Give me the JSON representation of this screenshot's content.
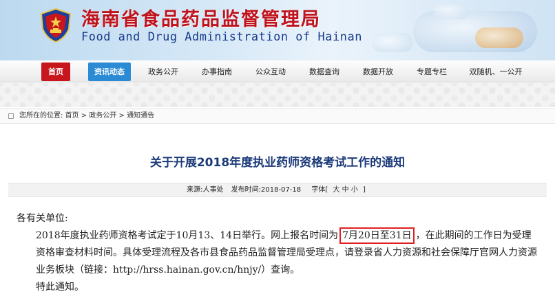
{
  "header": {
    "title_cn": "海南省食品药品监督管理局",
    "title_en": "Food and Drug Administration of Hainan",
    "emblem_icon": "police-emblem-icon",
    "title_color": "#c0121b",
    "subtitle_color": "#1a3c8c"
  },
  "nav": {
    "items": [
      {
        "label": "首页"
      },
      {
        "label": "资讯动态"
      },
      {
        "label": "政务公开"
      },
      {
        "label": "办事指南"
      },
      {
        "label": "公众互动"
      },
      {
        "label": "数据查询"
      },
      {
        "label": "数据开放"
      },
      {
        "label": "专题专栏"
      },
      {
        "label": "双随机、一公开"
      }
    ],
    "home_color": "#c8161d",
    "active_color": "#2a8ad3"
  },
  "breadcrumb": {
    "prefix": "您所在的位置:",
    "items": [
      "首页",
      "政务公开",
      "通知通告"
    ],
    "separator": ">"
  },
  "article": {
    "title": "关于开展2018年度执业药师资格考试工作的通知",
    "meta": {
      "source": "来源:人事处",
      "date": "发布时间:2018-07-18",
      "font_label": "字体[",
      "font_sizes": [
        "大",
        "中",
        "小"
      ],
      "font_close": "]"
    },
    "salutation": "各有关单位:",
    "para1_a": "2018年度执业药师资格考试定于10月13、14日举行。网上报名时间为",
    "para1_highlight": "7月20日至31日",
    "para1_b": "，在此期间的工作日为受理资格审查材料时间。具体受理流程及各市县食品药品监督管理局受理点，请登录省人力资源和社会保障厅官网人力资源业务板块（链接：http://hrss.hainan.gov.cn/hnjy/）查询。",
    "closing": "特此通知。"
  }
}
